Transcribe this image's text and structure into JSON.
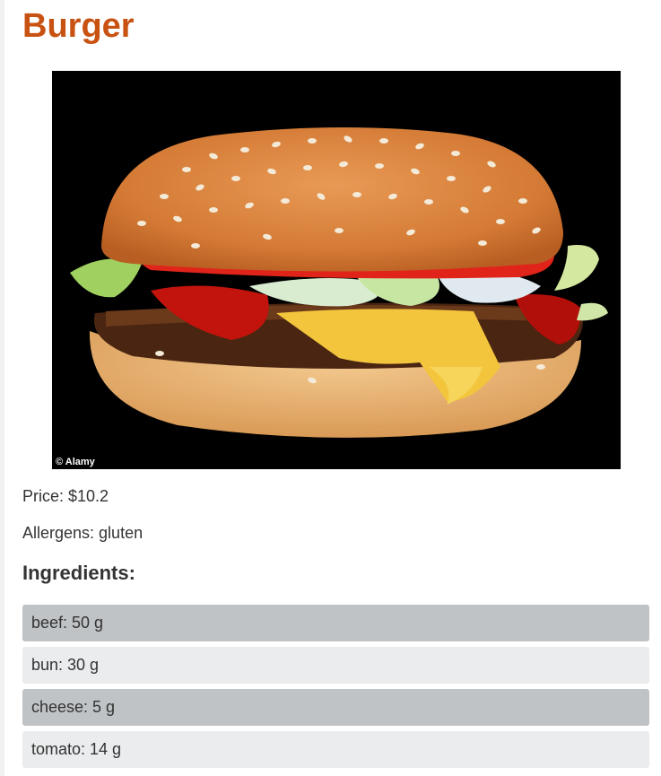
{
  "dish": {
    "title": "Burger",
    "photo_credit": "© Alamy",
    "price_text": "Price: $10.2",
    "allergens_text": "Allergens: gluten",
    "ingredients_heading": "Ingredients:"
  },
  "ingredients": [
    "beef: 50 g",
    "bun: 30 g",
    "cheese: 5 g",
    "tomato: 14 g"
  ]
}
